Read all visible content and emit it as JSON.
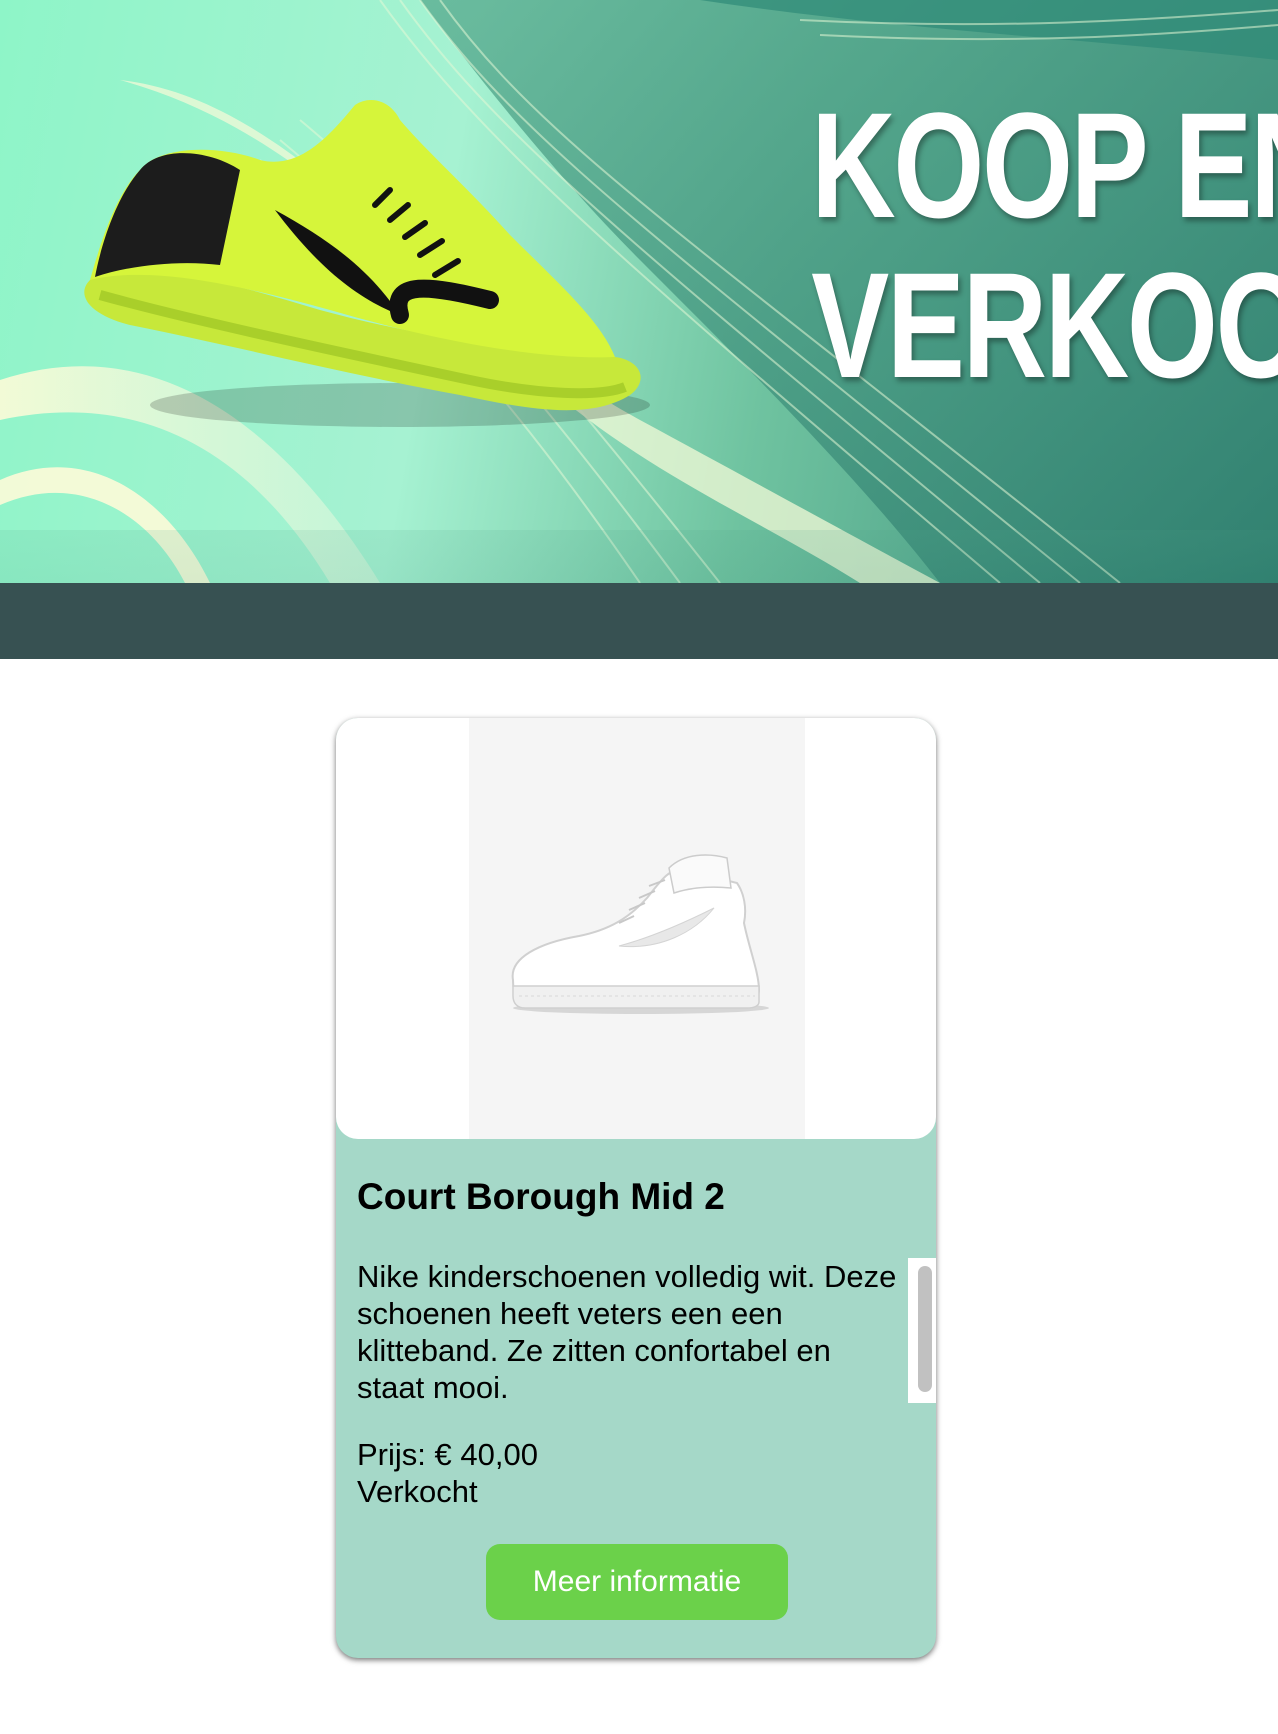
{
  "hero": {
    "title_line1": "KOOP EN",
    "title_line2": "VERKOOP",
    "image": "neon-running-shoe-icon"
  },
  "product": {
    "image": "white-sneaker-icon",
    "name": "Court Borough Mid 2",
    "description": "Nike kinderschoenen volledig wit. Deze schoenen heeft veters een een klitteband. Ze zitten confortabel en staat mooi.",
    "price": "Prijs: € 40,00",
    "status": "Verkocht",
    "button_label": "Meer informatie"
  },
  "colors": {
    "navbar": "#375152",
    "card_background": "#a5d8c8",
    "button": "#6bd14a",
    "hero_shoe": "#d6f53a"
  }
}
